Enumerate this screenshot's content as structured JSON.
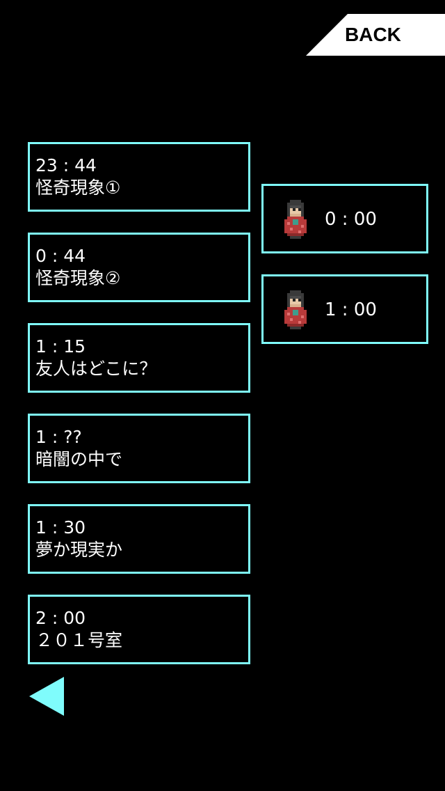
{
  "header": {
    "back_label": "BACK"
  },
  "chapters": [
    {
      "time": "23 : 44",
      "title": "怪奇現象①"
    },
    {
      "time": "0 : 44",
      "title": "怪奇現象②"
    },
    {
      "time": "1 : 15",
      "title": "友人はどこに？"
    },
    {
      "time": "1 : ??",
      "title": "暗闇の中で"
    },
    {
      "time": "1 : 30",
      "title": "夢か現実か"
    },
    {
      "time": "2 : 00",
      "title": "２０１号室"
    }
  ],
  "endings": [
    {
      "time": "0 : 00",
      "icon": "ghost-girl-sprite-icon"
    },
    {
      "time": "1 : 00",
      "icon": "ghost-girl-sprite-icon"
    }
  ],
  "nav": {
    "prev_icon": "triangle-left-icon"
  },
  "colors": {
    "background": "#000000",
    "accent": "#7ffcfc",
    "text": "#ffffff",
    "back_button_bg": "#ffffff"
  }
}
